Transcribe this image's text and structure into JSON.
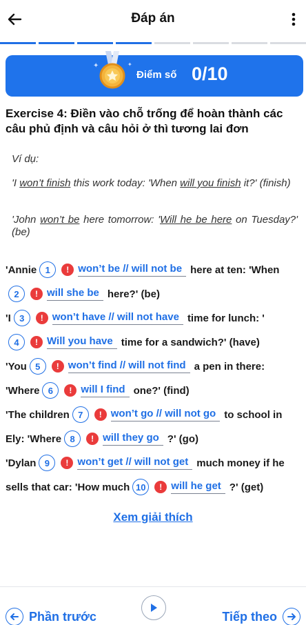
{
  "header": {
    "title": "Đáp án"
  },
  "progress": {
    "segments_total": 8,
    "segments_done": 4
  },
  "score": {
    "label": "Điểm số",
    "value": "0/10"
  },
  "exercise": {
    "title": "Exercise 4: Điền vào chỗ trống để hoàn thành các câu phủ định và câu hỏi ở thì tương lai đơn"
  },
  "example": {
    "label": "Ví dụ:",
    "line1": {
      "a": "'I ",
      "u1": "won’t finish",
      "b": " this work today: 'When ",
      "u2": "will you finish",
      "c": " it?' (finish)"
    },
    "line2": {
      "a": "'John ",
      "u1": "won’t be",
      "b": " here tomorrow: '",
      "u2": "Will he be here",
      "c": " on Tuesday?' (be)"
    }
  },
  "lines": {
    "l1": {
      "pre": "'Annie",
      "num": "1",
      "ans": "won’t be // will not be",
      "post": "here at ten: 'When"
    },
    "l2": {
      "num": "2",
      "ans": "will she be",
      "post": "here?' (be)"
    },
    "l3": {
      "pre": "'I",
      "num": "3",
      "ans": "won’t have // will not have",
      "post": "time for lunch: '"
    },
    "l4": {
      "num": "4",
      "ans": "Will you have",
      "post": "time for a sandwich?' (have)"
    },
    "l5": {
      "pre": "'You",
      "num": "5",
      "ans": "won’t find // will not find",
      "post": "a pen in there:"
    },
    "l6": {
      "pre": "'Where",
      "num": "6",
      "ans": "will I find",
      "post": "one?' (find)"
    },
    "l7": {
      "pre": "'The children",
      "num": "7",
      "ans": "won’t go // will not go",
      "post": "to school in"
    },
    "l8": {
      "pre": "Ely: 'Where",
      "num": "8",
      "ans": "will they go",
      "post": "?' (go)"
    },
    "l9": {
      "pre": "'Dylan",
      "num": "9",
      "ans": "won’t get // will not get",
      "post": "much money if he"
    },
    "l10": {
      "pre": "sells that car: 'How much",
      "num": "10",
      "ans": "will he get",
      "post": "?' (get)"
    }
  },
  "explain_link": "Xem giải thích",
  "nav": {
    "prev": "Phần trước",
    "next": "Tiếp theo"
  },
  "colors": {
    "accent": "#1f6fe5",
    "score_card": "#1f73eb",
    "error": "#ea3b3b"
  },
  "icons": {
    "back": "arrow-left-icon",
    "more": "more-vertical-icon",
    "medal": "medal-icon",
    "error": "exclamation-icon",
    "play": "play-icon",
    "next": "arrow-right-icon"
  }
}
